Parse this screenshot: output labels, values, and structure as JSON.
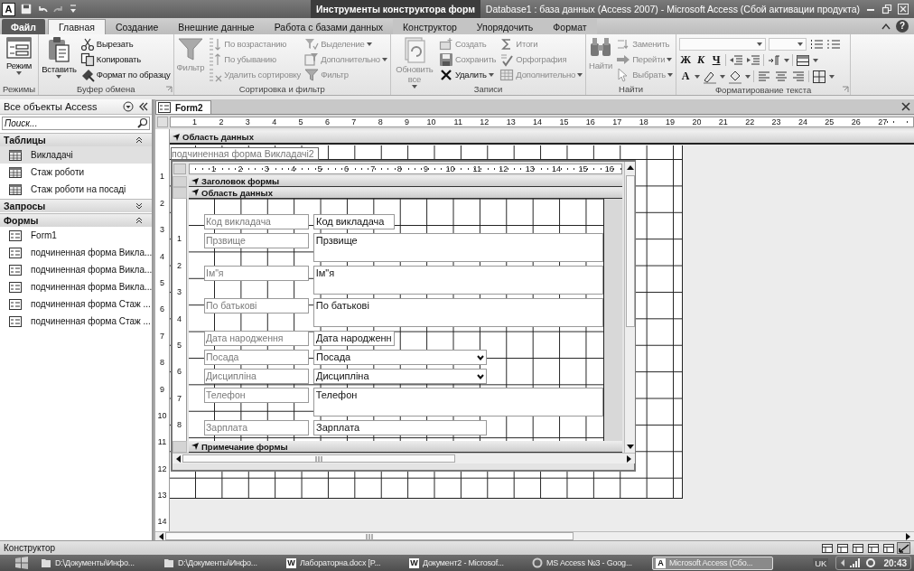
{
  "title_bar": {
    "app_logo": "A",
    "context_group": "Инструменты конструктора форм",
    "title": "Database1 : база данных (Access 2007)  -  Microsoft Access (Сбой активации продукта)"
  },
  "ribbon_tabs": [
    {
      "label": "Файл",
      "kind": "file",
      "selected": false
    },
    {
      "label": "Главная",
      "kind": "tab",
      "selected": true
    },
    {
      "label": "Создание",
      "kind": "tab",
      "selected": false
    },
    {
      "label": "Внешние данные",
      "kind": "tab",
      "selected": false
    },
    {
      "label": "Работа с базами данных",
      "kind": "tab",
      "selected": false
    },
    {
      "label": "Конструктор",
      "kind": "context",
      "selected": false
    },
    {
      "label": "Упорядочить",
      "kind": "context",
      "selected": false
    },
    {
      "label": "Формат",
      "kind": "context",
      "selected": false
    }
  ],
  "help_button": "?",
  "ribbon_groups": [
    {
      "title": "Режимы",
      "kind": "buttons",
      "launcher": false,
      "buttons": [
        {
          "label": "Режим",
          "kind": "large",
          "dropdown": true,
          "disabled": false
        }
      ]
    },
    {
      "title": "Буфер обмена",
      "kind": "buttons",
      "launcher": true,
      "buttons": [
        {
          "label": "Вставить",
          "kind": "large",
          "dropdown": true,
          "disabled": false
        },
        {
          "label": "Вырезать",
          "kind": "small",
          "dropdown": false,
          "disabled": false
        },
        {
          "label": "Копировать",
          "kind": "small",
          "dropdown": false,
          "disabled": false
        },
        {
          "label": "Формат по образцу",
          "kind": "small",
          "dropdown": false,
          "disabled": false
        }
      ]
    },
    {
      "title": "Сортировка и фильтр",
      "kind": "buttons",
      "launcher": false,
      "buttons": [
        {
          "label": "Фильтр",
          "kind": "large",
          "dropdown": false,
          "disabled": true
        },
        {
          "label": "По возрастанию",
          "kind": "small",
          "dropdown": false,
          "disabled": true
        },
        {
          "label": "По убыванию",
          "kind": "small",
          "dropdown": false,
          "disabled": true
        },
        {
          "label": "Удалить сортировку",
          "kind": "small",
          "dropdown": false,
          "disabled": true
        },
        {
          "label": "Выделение",
          "kind": "small",
          "dropdown": true,
          "disabled": true
        },
        {
          "label": "Дополнительно",
          "kind": "small",
          "dropdown": true,
          "disabled": true
        },
        {
          "label": "Фильтр",
          "kind": "small",
          "dropdown": false,
          "disabled": true
        }
      ]
    },
    {
      "title": "Записи",
      "kind": "buttons",
      "launcher": false,
      "buttons": [
        {
          "label": "Обновить все",
          "kind": "large",
          "dropdown": true,
          "disabled": true
        },
        {
          "label": "Создать",
          "kind": "small",
          "dropdown": false,
          "disabled": true
        },
        {
          "label": "Сохранить",
          "kind": "small",
          "dropdown": false,
          "disabled": true
        },
        {
          "label": "Удалить",
          "kind": "small",
          "dropdown": true,
          "disabled": false
        },
        {
          "label": "Итоги",
          "kind": "small",
          "dropdown": false,
          "disabled": true
        },
        {
          "label": "Орфография",
          "kind": "small",
          "dropdown": false,
          "disabled": true
        },
        {
          "label": "Дополнительно",
          "kind": "small",
          "dropdown": true,
          "disabled": true
        }
      ]
    },
    {
      "title": "Найти",
      "kind": "buttons",
      "launcher": false,
      "buttons": [
        {
          "label": "Найти",
          "kind": "large",
          "dropdown": false,
          "disabled": true
        },
        {
          "label": "Заменить",
          "kind": "small",
          "dropdown": false,
          "disabled": true
        },
        {
          "label": "Перейти",
          "kind": "small",
          "dropdown": true,
          "disabled": true
        },
        {
          "label": "Выбрать",
          "kind": "small",
          "dropdown": true,
          "disabled": true
        }
      ]
    },
    {
      "title": "Форматирование текста",
      "kind": "format",
      "launcher": true,
      "style_buttons": [
        "Ж",
        "К",
        "Ч"
      ],
      "font_color_button": "A"
    }
  ],
  "nav_pane": {
    "title": "Все объекты Access",
    "search_placeholder": "Поиск...",
    "groups": [
      {
        "title": "Таблицы",
        "expanded": true,
        "items": [
          {
            "label": "Викладачі",
            "kind": "table",
            "selected": true
          },
          {
            "label": "Стаж роботи",
            "kind": "table",
            "selected": false
          },
          {
            "label": "Стаж роботи на посаді",
            "kind": "table",
            "selected": false
          }
        ]
      },
      {
        "title": "Запросы",
        "expanded": false
      },
      {
        "title": "Формы",
        "expanded": true,
        "items": [
          {
            "label": "Form1",
            "kind": "form",
            "selected": false
          },
          {
            "label": "подчиненная форма Викла...",
            "kind": "form",
            "selected": false
          },
          {
            "label": "подчиненная форма Викла...",
            "kind": "form",
            "selected": false
          },
          {
            "label": "подчиненная форма Викла...",
            "kind": "form",
            "selected": false
          },
          {
            "label": "подчиненная форма Стаж ...",
            "kind": "form",
            "selected": false
          },
          {
            "label": "подчиненная форма Стаж ...",
            "kind": "form",
            "selected": false
          }
        ]
      }
    ]
  },
  "document": {
    "tab": "Form2",
    "ruler_numbers": [
      "1",
      "2",
      "3",
      "4",
      "5",
      "6",
      "7",
      "8",
      "9",
      "10",
      "11",
      "12",
      "13",
      "14",
      "15",
      "16",
      "17",
      "18",
      "19",
      "20",
      "21",
      "22",
      "23",
      "24",
      "25",
      "26",
      "27"
    ],
    "side_ruler_numbers": [
      "1",
      "2",
      "3",
      "4",
      "5",
      "6",
      "7",
      "8",
      "9",
      "10",
      "11",
      "12",
      "13",
      "14"
    ],
    "section": "Область данных",
    "subform": {
      "label": "подчиненная форма Викладачі2",
      "ruler_numbers": [
        "1",
        "2",
        "3",
        "4",
        "5",
        "6",
        "7",
        "8",
        "9",
        "10",
        "11",
        "12",
        "13",
        "14",
        "15",
        "16"
      ],
      "side_ruler_numbers": [
        "1",
        "2",
        "3",
        "4",
        "5",
        "6",
        "7",
        "8"
      ],
      "header_section": "Заголовок формы",
      "detail_section": "Область данных",
      "footer_section": "Примечание формы",
      "fields": [
        {
          "label": "Код викладача",
          "value": "Код викладача",
          "kind": "short"
        },
        {
          "label": "Прзвище",
          "value": "Прзвище",
          "kind": "memo"
        },
        {
          "label": "Ім\"я",
          "value": "Ім\"я",
          "kind": "memo"
        },
        {
          "label": "По батькові",
          "value": "По батькові",
          "kind": "memo"
        },
        {
          "label": "Дата народження",
          "value": "Дата народженн",
          "kind": "short"
        },
        {
          "label": "Посада",
          "value": "Посада",
          "kind": "combo"
        },
        {
          "label": "Дисципліна",
          "value": "Дисципліна",
          "kind": "combo"
        },
        {
          "label": "Телефон",
          "value": "Телефон",
          "kind": "memo"
        },
        {
          "label": "Зарплата",
          "value": "Зарплата",
          "kind": "text"
        }
      ]
    }
  },
  "status_bar": {
    "text": "Конструктор",
    "view_buttons": [
      {
        "selected": false
      },
      {
        "selected": false
      },
      {
        "selected": false
      },
      {
        "selected": false
      },
      {
        "selected": false
      },
      {
        "selected": true
      }
    ]
  },
  "taskbar": {
    "items": [
      {
        "label": "D:\\Документы\\Инфо...",
        "kind": "folder",
        "selected": false
      },
      {
        "label": "D:\\Документы\\Инфо...",
        "kind": "folder",
        "selected": false
      },
      {
        "label": "Лабораторна.docx [P...",
        "kind": "app",
        "badge": "W",
        "selected": false
      },
      {
        "label": "Документ2 - Microsof...",
        "kind": "app",
        "badge": "W",
        "selected": false
      },
      {
        "label": "MS Access №3 - Goog...",
        "kind": "browser",
        "selected": false
      },
      {
        "label": "Microsoft Access (Сбо...",
        "kind": "app",
        "badge": "A",
        "selected": true
      }
    ],
    "language": "UK",
    "clock": "20:43"
  }
}
